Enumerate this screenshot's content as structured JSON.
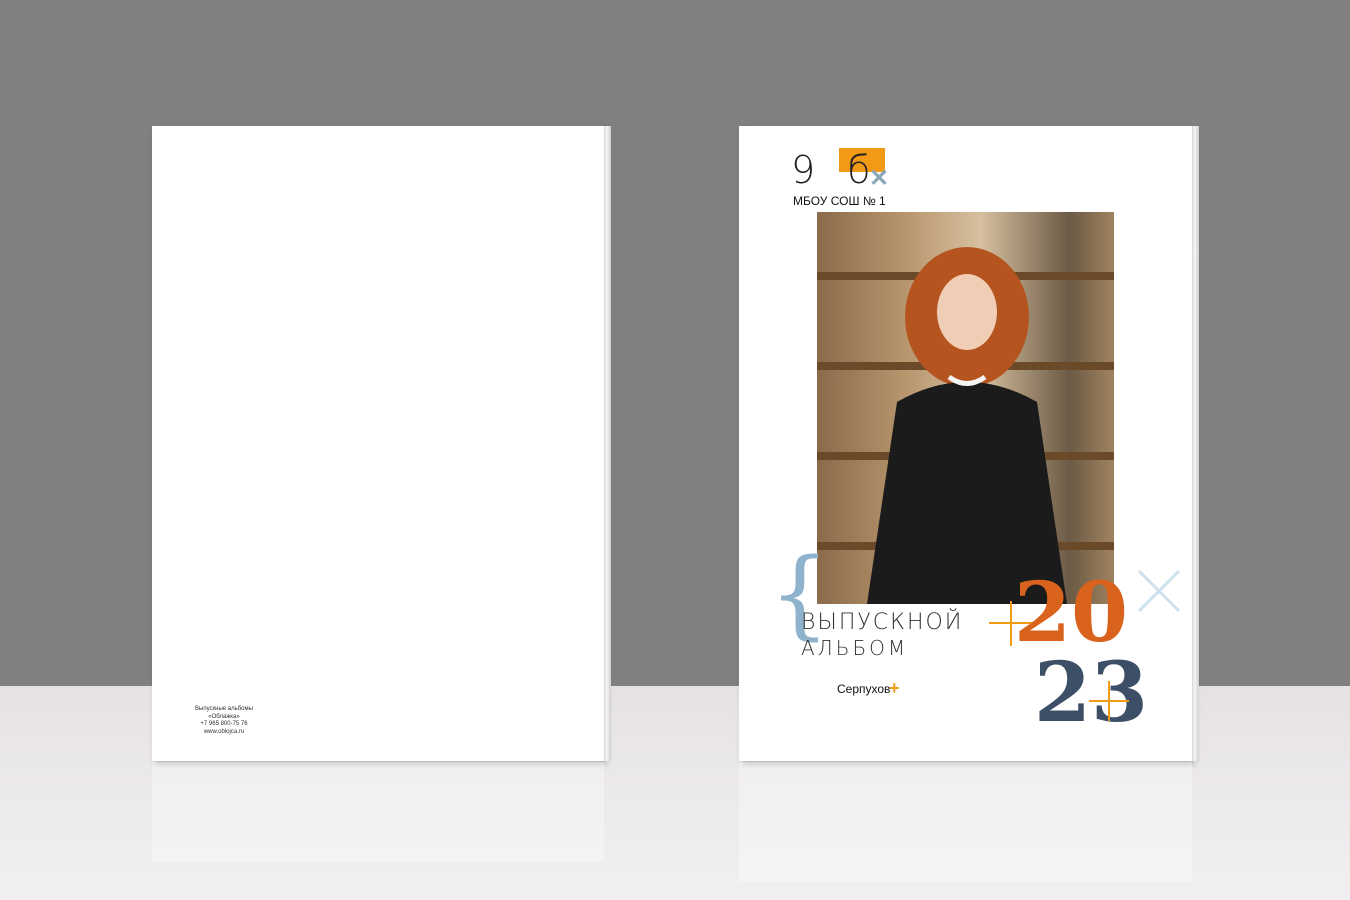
{
  "back_cover": {
    "imprint_lines": [
      "Выпускные альбомы",
      "«Облажка»",
      "+7 965 800-75 76",
      "www.oblojca.ru"
    ]
  },
  "front_cover": {
    "class": "9 б",
    "school": "МБОУ СОШ № 1",
    "title_line1": "ВЫПУСКНОЙ",
    "title_line2": "АЛЬБОМ",
    "city": "Серпухов",
    "year_top": "20",
    "year_bottom": "23",
    "accent_color": "#f29a16",
    "secondary_color": "#8fb3cc",
    "dark_color": "#3d4f66"
  }
}
